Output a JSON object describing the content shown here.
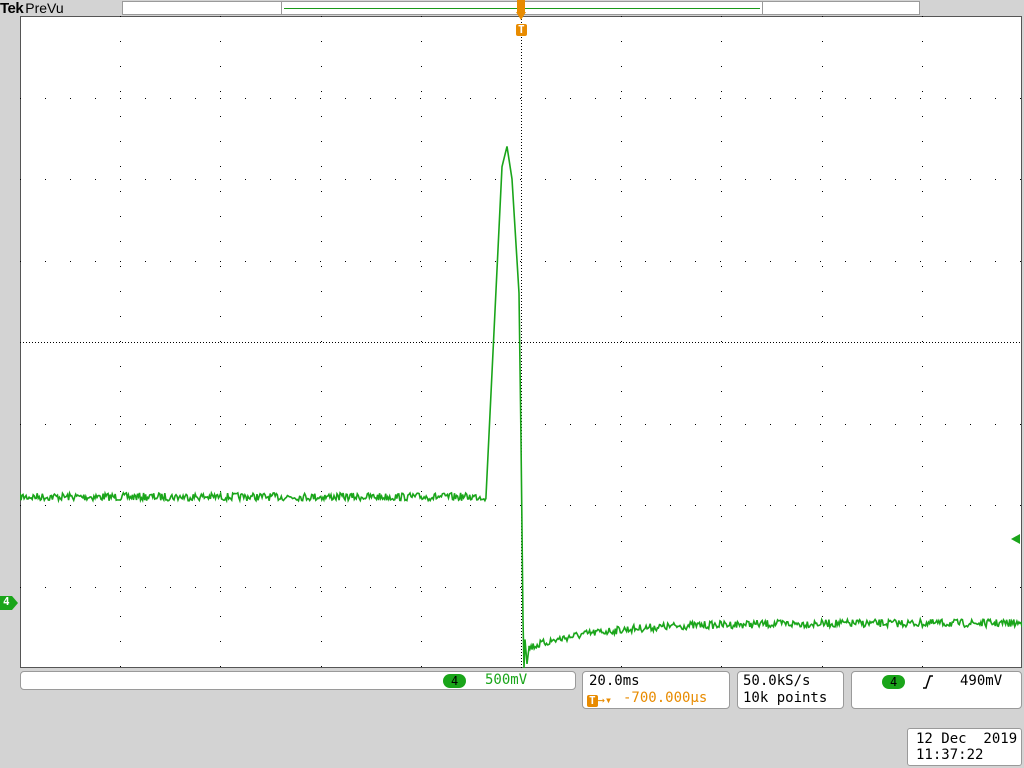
{
  "header": {
    "brand": "Tek",
    "mode": "PreVu"
  },
  "colors": {
    "trace": "#1aa51a",
    "trigger": "#e88b00",
    "grid": "#000000",
    "background": "#ffffff",
    "frame": "#d3d3d3"
  },
  "markers": {
    "trigger_label": "T",
    "channel_label": "4"
  },
  "channel": {
    "number": "4",
    "scale": "500mV"
  },
  "timebase": {
    "scale": "20.0ms",
    "trigger_position": "-700.000µs"
  },
  "acquisition": {
    "sample_rate": "50.0kS/s",
    "record_length": "10k points"
  },
  "trigger": {
    "source": "4",
    "slope_icon": "rising-edge-icon",
    "level": "490mV"
  },
  "timestamp": {
    "date": "12 Dec  2019",
    "time": "11:37:22"
  },
  "waveform": {
    "description_units": "divisions (x: 0-10 horizontal, y: 0-8 vertical from top)",
    "baseline_level_div": 5.9,
    "rise_start_div": 4.65,
    "peak": {
      "x_div": 4.86,
      "y_div": 1.6
    },
    "fall_end_div": 5.02,
    "undershoot_div": 8.0,
    "recovery_start_div": 7.75,
    "recovery_end_div": 7.45,
    "trigger_level_div": 6.1,
    "ground_div": 6.6
  }
}
